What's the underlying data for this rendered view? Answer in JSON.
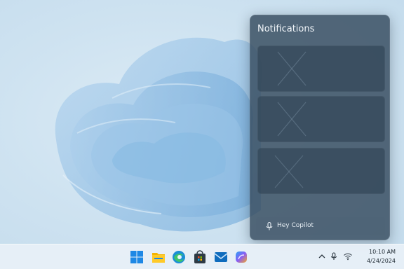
{
  "notifications": {
    "title": "Notifications",
    "cards": [
      {
        "kind": "placeholder"
      },
      {
        "kind": "placeholder"
      },
      {
        "kind": "placeholder"
      }
    ],
    "copilot_placeholder": "Hey Copilot"
  },
  "taskbar": {
    "apps": [
      {
        "name": "start",
        "icon": "windows-logo-icon"
      },
      {
        "name": "file-explorer",
        "icon": "folder-icon"
      },
      {
        "name": "edge",
        "icon": "edge-browser-icon"
      },
      {
        "name": "store",
        "icon": "store-icon"
      },
      {
        "name": "mail",
        "icon": "mail-icon"
      },
      {
        "name": "copilot",
        "icon": "copilot-icon"
      }
    ],
    "tray": [
      "chevron-up-icon",
      "microphone-icon",
      "wifi-icon"
    ],
    "clock": {
      "time": "10:10 AM",
      "date": "4/24/2024"
    }
  },
  "colors": {
    "accent": "#0f6cbd",
    "panel": "#384e60",
    "wallpaper": "#cfe3f1"
  }
}
